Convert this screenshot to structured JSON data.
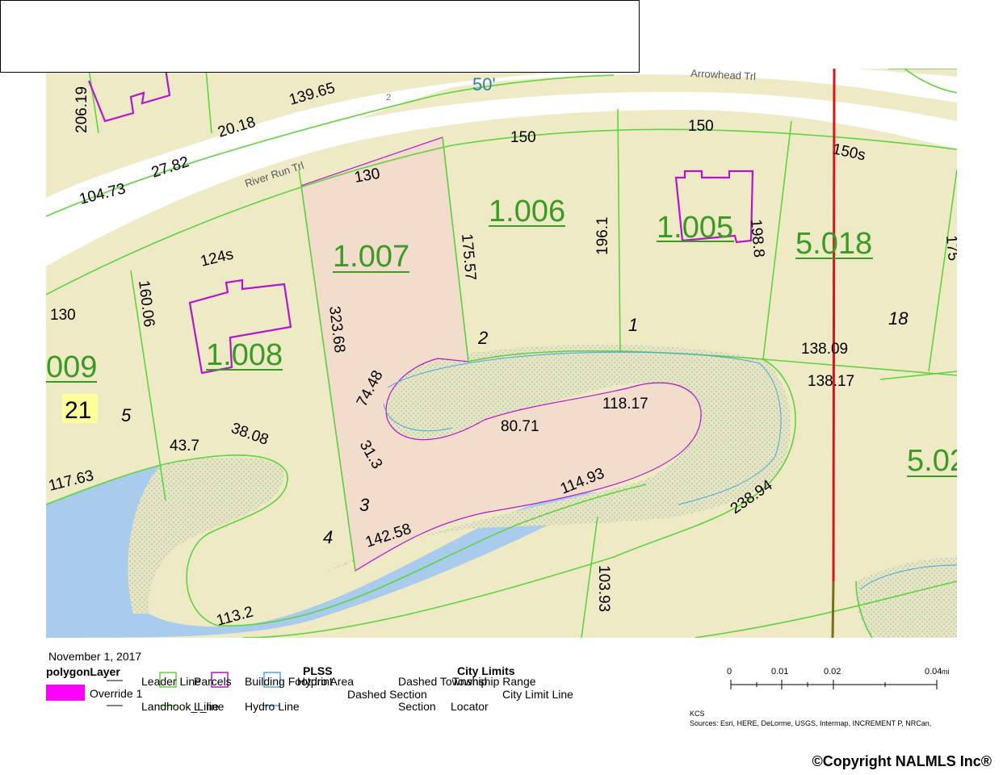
{
  "map": {
    "roads": [
      "Arrowhead Trl",
      "River Run Trl",
      "50'",
      "2"
    ],
    "parcel_ids": [
      "1.006",
      "1.007",
      "1.005",
      "5.018",
      "1.008",
      "009",
      "5.02",
      "21"
    ],
    "dimensions": [
      "206.19",
      "139.65",
      "20.18",
      "104.73",
      "27.82",
      "150",
      "150",
      "150s",
      "130",
      "175.57",
      "196.1",
      "198.8",
      "175",
      "124s",
      "160.06",
      "130",
      "323.68",
      "138.09",
      "138.17",
      "74.48",
      "118.17",
      "80.71",
      "31.3",
      "43.7",
      "38.08",
      "117.63",
      "114.93",
      "238.94",
      "142.58",
      "113.2",
      "103.93"
    ],
    "lot_numbers": [
      "2",
      "1",
      "18",
      "5",
      "3",
      "4"
    ],
    "colors": {
      "land": "#efeac6",
      "road": "#ffffff",
      "water": "#a9cbec",
      "flood": "#e7e6c4",
      "selected": "#f2dccc",
      "parcel_line": "#5fd23e",
      "building": "#b515c9",
      "red_line": "#d41818",
      "label_green": "#3a9a22"
    }
  },
  "legend": {
    "date": "November 1, 2017",
    "layer": "polygonLayer",
    "override": "Override 1",
    "leader_line": "Leader Line",
    "landhook_line": "Landhook_Line",
    "parcels": "Parcels",
    "l_line": "L_line",
    "building_footprint": "Building Footprint",
    "hydro_line": "Hydro Line",
    "hydro_area": "Hydro Area",
    "plss": "PLSS",
    "dashed_section": "Dashed Section",
    "dashed_township": "Dashed Township",
    "township_range": "Township Range",
    "section": "Section",
    "city_limits": "City Limits",
    "city_limit_line": "City Limit Line",
    "locator": "Locator"
  },
  "scale": {
    "ticks": [
      "0",
      "0.01",
      "0.02",
      "0.04"
    ],
    "unit": "mi"
  },
  "attribution": {
    "line1": "KCS",
    "line2": "Sources: Esri, HERE, DeLorme, USGS, Intermap, INCREMENT P, NRCan,"
  },
  "copyright": "©Copyright NALMLS Inc®"
}
